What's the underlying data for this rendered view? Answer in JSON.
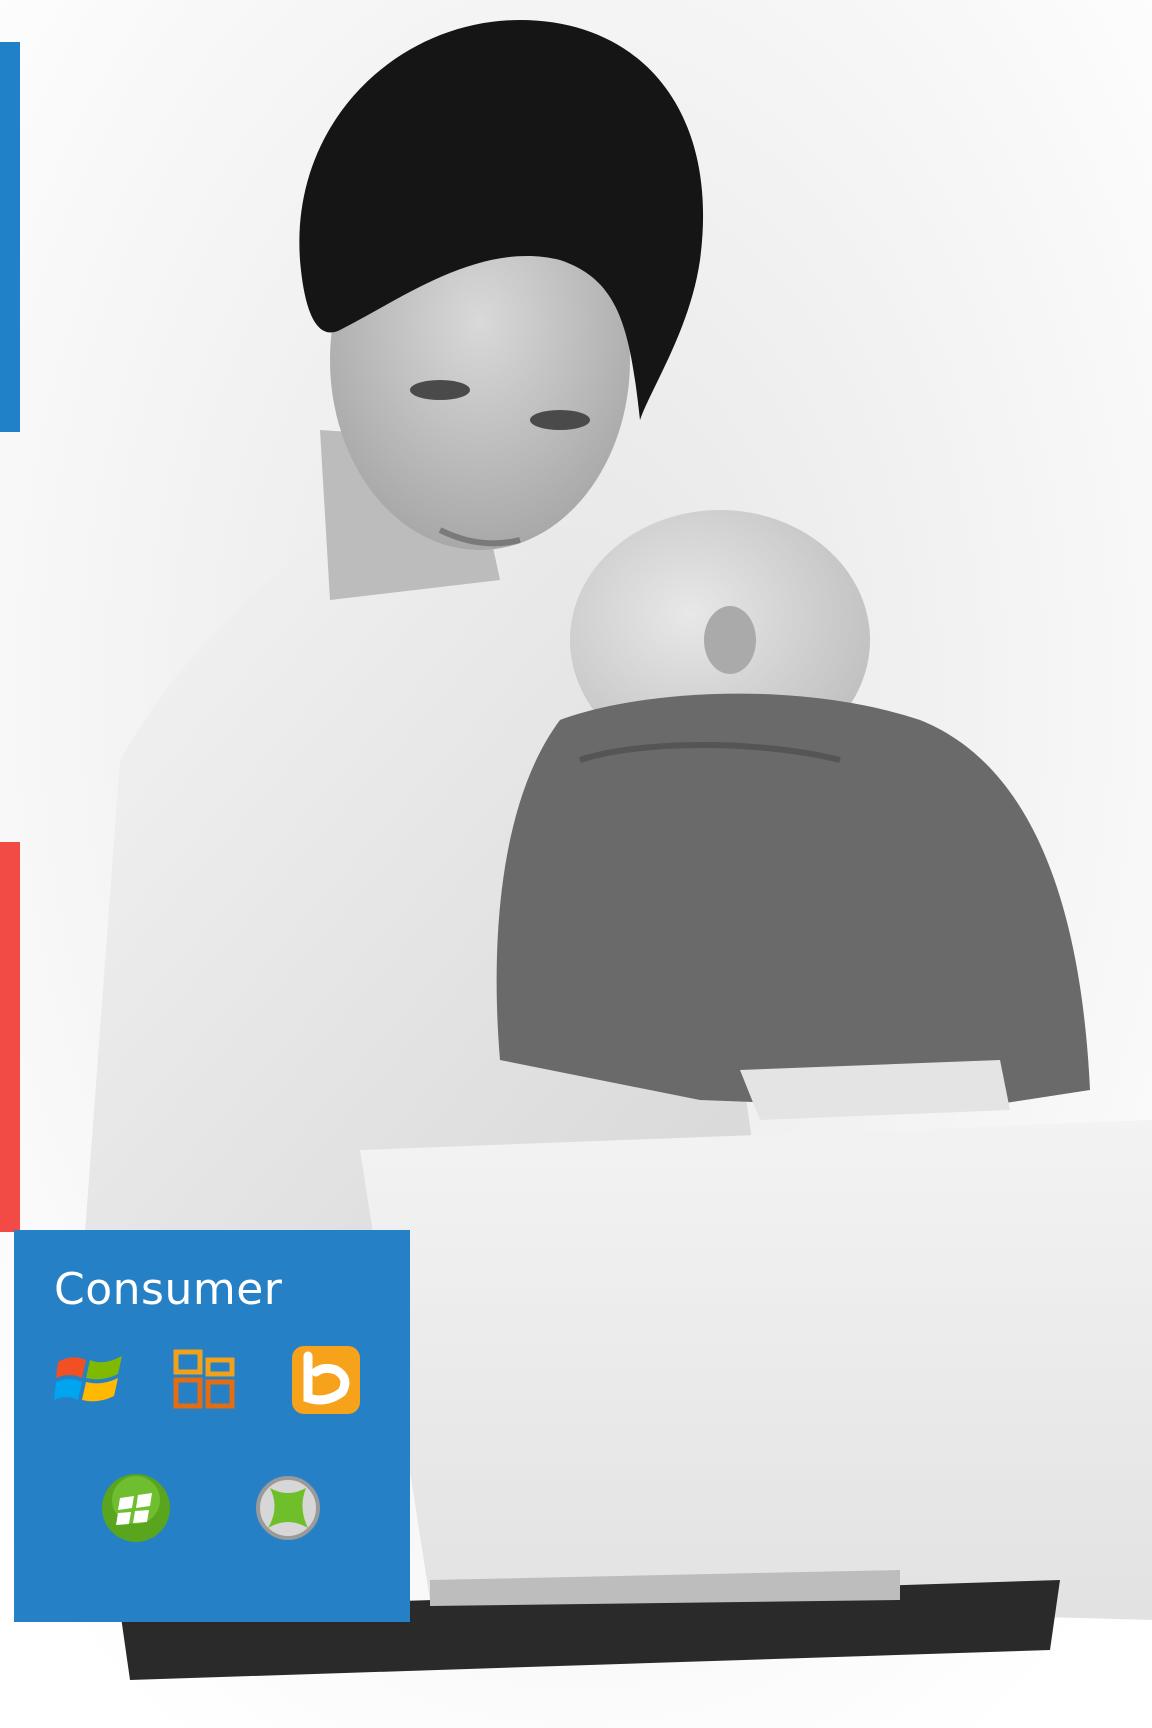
{
  "tile": {
    "title": "Consumer",
    "background_color": "#2680c6",
    "logos": [
      "windows-logo",
      "office-logo",
      "bing-logo",
      "windows-phone-logo",
      "xbox-logo"
    ]
  },
  "accents": {
    "top_color": "#2080c8",
    "bottom_color": "#f24a44"
  },
  "photo": {
    "subject": "woman-holding-baby-using-laptop",
    "style": "black-and-white"
  }
}
